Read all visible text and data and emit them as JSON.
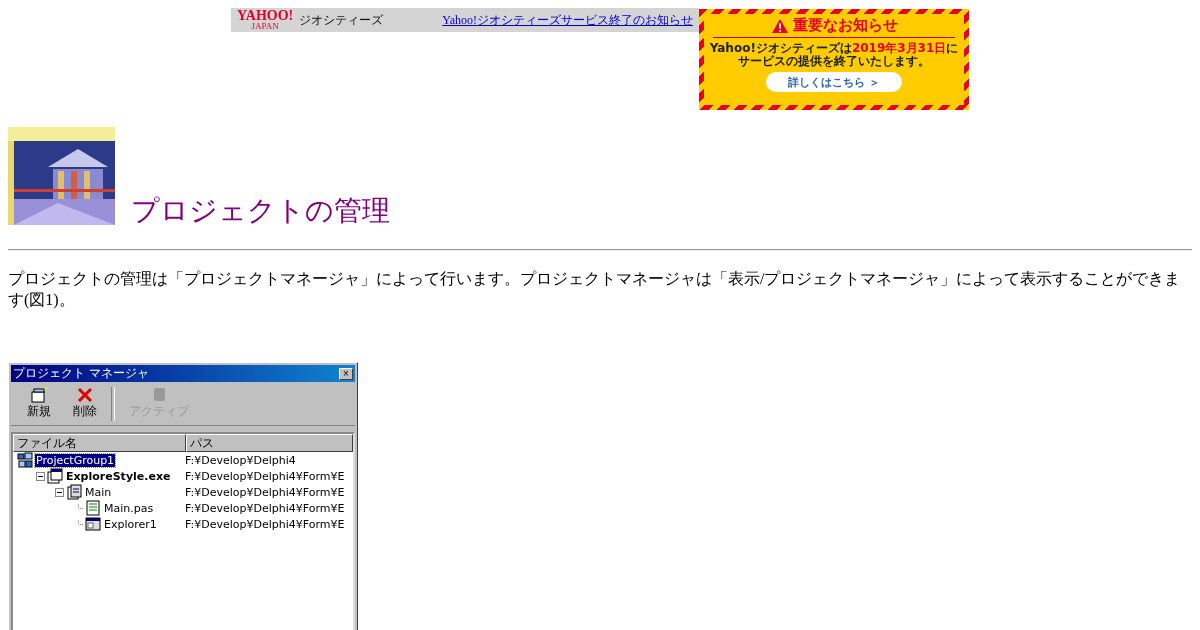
{
  "banner": {
    "logo": "YAHOO!",
    "logo_sub": "JAPAN",
    "service": "ジオシティーズ",
    "link": "Yahoo!ジオシティーズサービス終了のお知らせ"
  },
  "notice": {
    "title": "重要なお知らせ",
    "body_lead": "Yahoo!ジオシティーズは",
    "body_date": "2019年3月31日",
    "body_tail": "に",
    "body_line2": "サービスの提供を終了いたします。",
    "button": "詳しくはこちら ＞"
  },
  "heading": "プロジェクトの管理",
  "paragraph": "プロジェクトの管理は「プロジェクトマネージャ」によって行います。プロジェクトマネージャは「表示/プロジェクトマネージャ」によって表示することができます(図1)。",
  "window": {
    "title": "プロジェクト マネージャ",
    "close": "×",
    "toolbar": [
      {
        "label": "新規",
        "kind": "new",
        "disabled": false
      },
      {
        "label": "削除",
        "kind": "delete",
        "disabled": false
      },
      {
        "label": "アクティブ",
        "kind": "activate",
        "disabled": true
      }
    ],
    "columns": [
      "ファイル名",
      "パス"
    ],
    "tree": [
      {
        "name": "ProjectGroup1",
        "path": "F:¥Develop¥Delphi4",
        "kind": "group",
        "selected": true,
        "active": false,
        "children": [
          {
            "name": "ExploreStyle.exe",
            "path": "F:¥Develop¥Delphi4¥Form¥E",
            "kind": "project",
            "selected": false,
            "active": true,
            "expanded": true,
            "children": [
              {
                "name": "Main",
                "path": "F:¥Develop¥Delphi4¥Form¥E",
                "kind": "unit",
                "selected": false,
                "active": false,
                "expanded": true,
                "children": [
                  {
                    "name": "Main.pas",
                    "path": "F:¥Develop¥Delphi4¥Form¥E",
                    "kind": "source",
                    "selected": false,
                    "active": false
                  },
                  {
                    "name": "Explorer1",
                    "path": "F:¥Develop¥Delphi4¥Form¥E",
                    "kind": "form",
                    "selected": false,
                    "active": false
                  }
                ]
              }
            ]
          }
        ]
      }
    ]
  }
}
